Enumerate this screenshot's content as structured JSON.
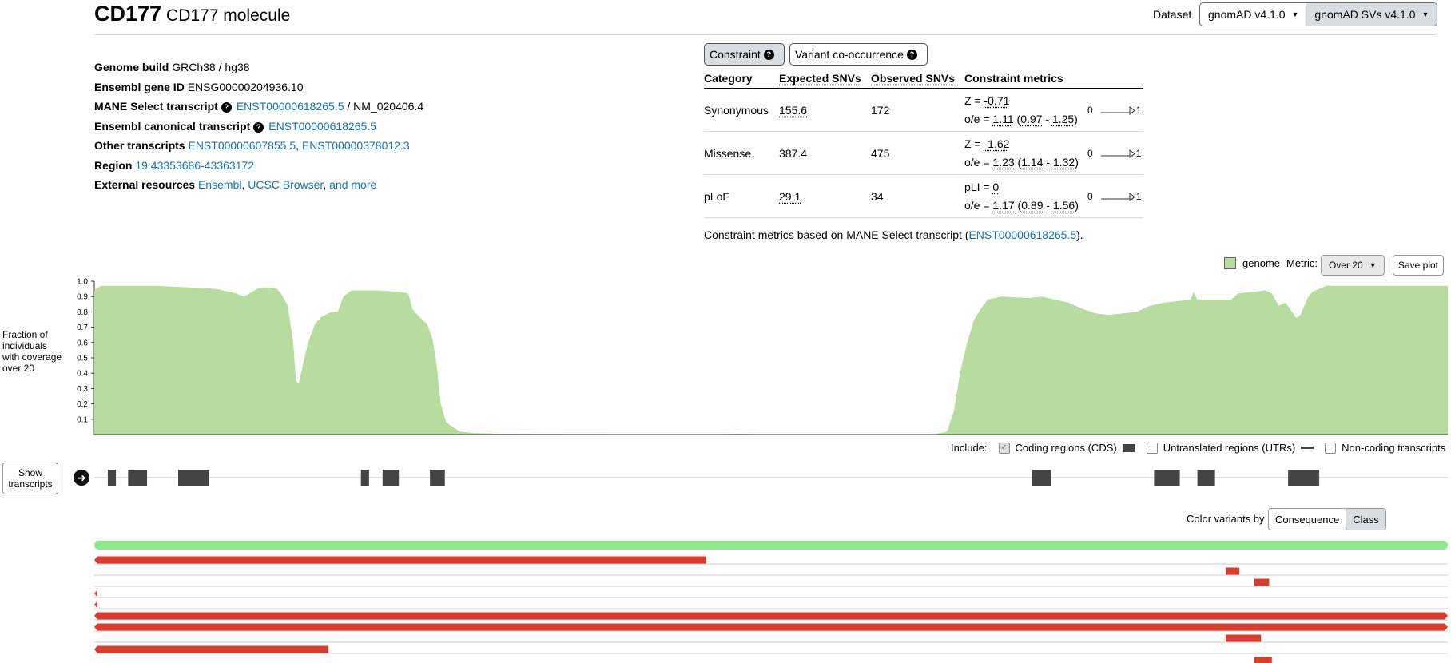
{
  "gene": {
    "symbol": "CD177",
    "name": "CD177 molecule"
  },
  "dataset": {
    "label": "Dataset",
    "options": [
      "gnomAD v4.1.0",
      "gnomAD SVs v4.1.0"
    ],
    "selected_index": 1
  },
  "info": {
    "genome_build_label": "Genome build",
    "genome_build": "GRCh38 / hg38",
    "ensembl_id_label": "Ensembl gene ID",
    "ensembl_id": "ENSG00000204936.10",
    "mane_label": "MANE Select transcript",
    "mane_ensembl": "ENST00000618265.5",
    "mane_sep": " / ",
    "mane_refseq": "NM_020406.4",
    "canonical_label": "Ensembl canonical transcript",
    "canonical": "ENST00000618265.5",
    "other_label": "Other transcripts",
    "other_1": "ENST00000607855.5",
    "other_sep": ", ",
    "other_2": "ENST00000378012.3",
    "region_label": "Region",
    "region": "19:43353686-43363172",
    "external_label": "External resources",
    "ext_1": "Ensembl",
    "ext_sep1": ", ",
    "ext_2": "UCSC Browser",
    "ext_sep2": ", ",
    "ext_3": "and more"
  },
  "constraint": {
    "tabs": [
      "Constraint",
      "Variant co-occurrence"
    ],
    "selected_tab": 0,
    "headers": [
      "Category",
      "Expected SNVs",
      "Observed SNVs",
      "Constraint metrics"
    ],
    "rows": [
      {
        "category": "Synonymous",
        "expected": "155.6",
        "observed": "172",
        "z_label": "Z = ",
        "z": "-0.71",
        "oe_label": "o/e = ",
        "oe": "1.11",
        "ci_open": " (",
        "ci_low": "0.97",
        "ci_sep": " - ",
        "ci_high": "1.25",
        "ci_close": ")",
        "oe_value": 1.11,
        "ci": [
          0.97,
          1.25
        ],
        "expected_underlined": true
      },
      {
        "category": "Missense",
        "expected": "387.4",
        "observed": "475",
        "z_label": "Z = ",
        "z": "-1.62",
        "oe_label": "o/e = ",
        "oe": "1.23",
        "ci_open": " (",
        "ci_low": "1.14",
        "ci_sep": " - ",
        "ci_high": "1.32",
        "ci_close": ")",
        "oe_value": 1.23,
        "ci": [
          1.14,
          1.32
        ],
        "expected_underlined": false
      },
      {
        "category": "pLoF",
        "expected": "29.1",
        "observed": "34",
        "z_label": "pLI = ",
        "z": "0",
        "oe_label": "o/e = ",
        "oe": "1.17",
        "ci_open": " (",
        "ci_low": "0.89",
        "ci_sep": " - ",
        "ci_high": "1.56",
        "ci_close": ")",
        "oe_value": 1.17,
        "ci": [
          0.89,
          1.56
        ],
        "expected_underlined": true
      }
    ],
    "bar_min": "0",
    "bar_max": "1",
    "footer_prefix": "Constraint metrics based on MANE Select transcript (",
    "footer_link": "ENST00000618265.5",
    "footer_suffix": ")."
  },
  "coverage": {
    "legend": "genome",
    "metric_label": "Metric:",
    "metric_value": "Over 20",
    "save_label": "Save plot",
    "ylabel": "Fraction of individuals with coverage over 20",
    "yticks": [
      "1.0",
      "0.9",
      "0.8",
      "0.7",
      "0.6",
      "0.5",
      "0.4",
      "0.3",
      "0.2",
      "0.1"
    ],
    "fill_color": "#b8dca0",
    "profile": [
      [
        0,
        0.94
      ],
      [
        0.005,
        0.97
      ],
      [
        0.02,
        0.97
      ],
      [
        0.045,
        0.97
      ],
      [
        0.07,
        0.96
      ],
      [
        0.09,
        0.95
      ],
      [
        0.1,
        0.93
      ],
      [
        0.105,
        0.92
      ],
      [
        0.11,
        0.9
      ],
      [
        0.113,
        0.91
      ],
      [
        0.12,
        0.95
      ],
      [
        0.125,
        0.96
      ],
      [
        0.13,
        0.96
      ],
      [
        0.135,
        0.95
      ],
      [
        0.138,
        0.92
      ],
      [
        0.143,
        0.84
      ],
      [
        0.147,
        0.6
      ],
      [
        0.149,
        0.35
      ],
      [
        0.151,
        0.33
      ],
      [
        0.154,
        0.45
      ],
      [
        0.158,
        0.6
      ],
      [
        0.163,
        0.72
      ],
      [
        0.168,
        0.77
      ],
      [
        0.173,
        0.79
      ],
      [
        0.176,
        0.8
      ],
      [
        0.18,
        0.8
      ],
      [
        0.184,
        0.9
      ],
      [
        0.19,
        0.94
      ],
      [
        0.21,
        0.94
      ],
      [
        0.225,
        0.93
      ],
      [
        0.232,
        0.92
      ],
      [
        0.235,
        0.82
      ],
      [
        0.24,
        0.77
      ],
      [
        0.246,
        0.72
      ],
      [
        0.25,
        0.62
      ],
      [
        0.253,
        0.45
      ],
      [
        0.256,
        0.2
      ],
      [
        0.26,
        0.08
      ],
      [
        0.27,
        0.02
      ],
      [
        0.28,
        0.01
      ],
      [
        0.3,
        0.005
      ],
      [
        0.45,
        0
      ],
      [
        0.475,
        0.005
      ],
      [
        0.5,
        0
      ],
      [
        0.62,
        0
      ],
      [
        0.63,
        0.02
      ],
      [
        0.635,
        0.15
      ],
      [
        0.64,
        0.42
      ],
      [
        0.645,
        0.6
      ],
      [
        0.65,
        0.75
      ],
      [
        0.655,
        0.82
      ],
      [
        0.66,
        0.88
      ],
      [
        0.67,
        0.9
      ],
      [
        0.69,
        0.89
      ],
      [
        0.7,
        0.9
      ],
      [
        0.71,
        0.88
      ],
      [
        0.72,
        0.86
      ],
      [
        0.73,
        0.82
      ],
      [
        0.74,
        0.79
      ],
      [
        0.75,
        0.78
      ],
      [
        0.76,
        0.79
      ],
      [
        0.77,
        0.8
      ],
      [
        0.78,
        0.84
      ],
      [
        0.79,
        0.86
      ],
      [
        0.8,
        0.87
      ],
      [
        0.81,
        0.88
      ],
      [
        0.812,
        0.93
      ],
      [
        0.815,
        0.88
      ],
      [
        0.83,
        0.88
      ],
      [
        0.84,
        0.88
      ],
      [
        0.845,
        0.92
      ],
      [
        0.855,
        0.93
      ],
      [
        0.865,
        0.94
      ],
      [
        0.87,
        0.92
      ],
      [
        0.875,
        0.84
      ],
      [
        0.88,
        0.86
      ],
      [
        0.885,
        0.8
      ],
      [
        0.888,
        0.76
      ],
      [
        0.891,
        0.78
      ],
      [
        0.897,
        0.9
      ],
      [
        0.9,
        0.93
      ],
      [
        0.91,
        0.97
      ],
      [
        0.95,
        0.97
      ],
      [
        1,
        0.97
      ]
    ]
  },
  "include": {
    "label": "Include:",
    "cds": "Coding regions (CDS)",
    "cds_checked": true,
    "utr": "Untranslated regions (UTRs)",
    "utr_checked": false,
    "noncoding": "Non-coding transcripts",
    "noncoding_checked": false
  },
  "transcripts": {
    "show_label": "Show transcripts",
    "exons": [
      [
        0.01,
        0.016
      ],
      [
        0.025,
        0.039
      ],
      [
        0.062,
        0.085
      ],
      [
        0.197,
        0.203
      ],
      [
        0.213,
        0.225
      ],
      [
        0.248,
        0.259
      ],
      [
        0.693,
        0.707
      ],
      [
        0.783,
        0.802
      ],
      [
        0.815,
        0.828
      ],
      [
        0.882,
        0.905
      ]
    ]
  },
  "color_by": {
    "label": "Color variants by",
    "options": [
      "Consequence",
      "Class"
    ],
    "selected_index": 1
  },
  "sv_tracks": {
    "green_color": "#8ee88e",
    "red_color": "#d63d2f",
    "rows": [
      {
        "start": 0.0,
        "end": 0.452,
        "arrow_left": true
      },
      {
        "start": 0.836,
        "end": 0.846
      },
      {
        "start": 0.857,
        "end": 0.868
      },
      {
        "start": 0.0,
        "end": 0.0,
        "arrow_left": true
      },
      {
        "start": 0.0,
        "end": 0.0,
        "arrow_left": true
      },
      {
        "start": 0.0,
        "end": 1.0,
        "arrow_left": true,
        "arrow_right": true
      },
      {
        "start": 0.0,
        "end": 1.0,
        "arrow_left": true,
        "arrow_right": true
      },
      {
        "start": 0.836,
        "end": 0.862
      },
      {
        "start": 0.0,
        "end": 0.173,
        "arrow_left": true
      },
      {
        "start": 0.857,
        "end": 0.87
      }
    ]
  }
}
